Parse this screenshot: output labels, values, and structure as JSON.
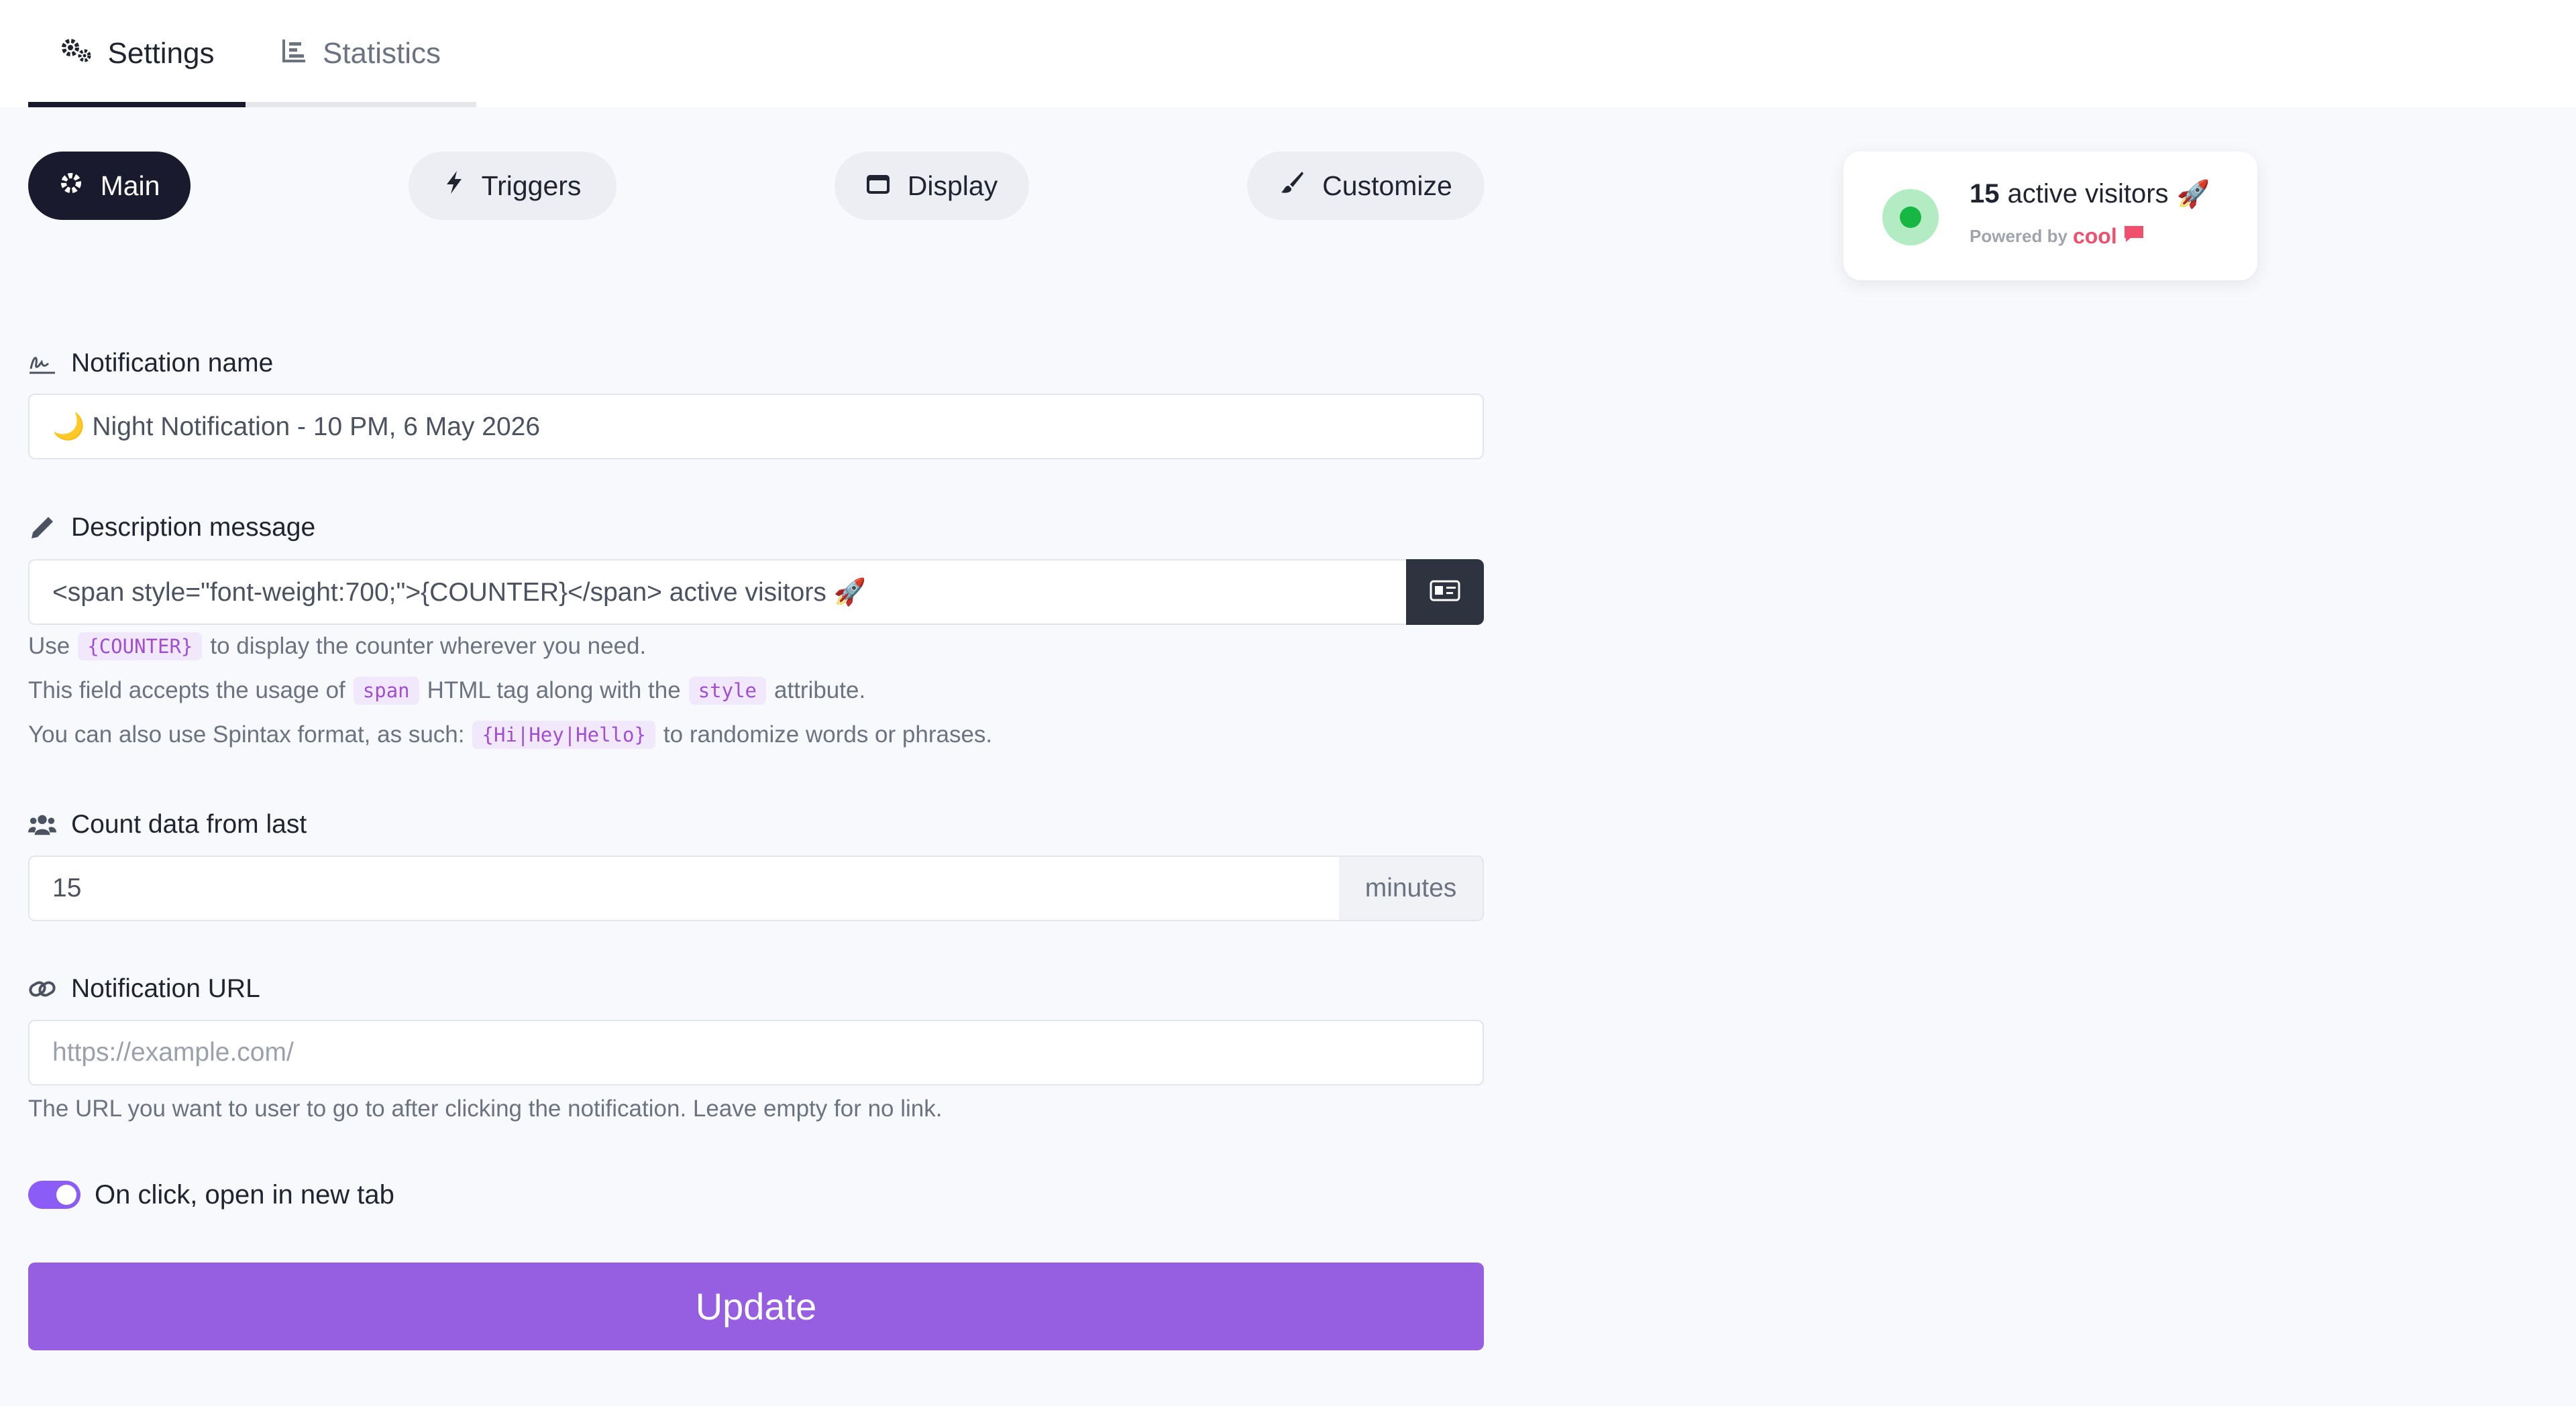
{
  "tabs": [
    {
      "label": "Settings",
      "icon": "gears-icon",
      "active": true
    },
    {
      "label": "Statistics",
      "icon": "bar-chart-icon",
      "active": false
    }
  ],
  "subnav": [
    {
      "label": "Main",
      "icon": "gear-icon",
      "active": true
    },
    {
      "label": "Triggers",
      "icon": "bolt-icon",
      "active": false
    },
    {
      "label": "Display",
      "icon": "window-icon",
      "active": false
    },
    {
      "label": "Customize",
      "icon": "paintbrush-icon",
      "active": false
    }
  ],
  "fields": {
    "name": {
      "label": "Notification name",
      "icon": "signature-icon",
      "value": "🌙 Night Notification - 10 PM, 6 May 2026"
    },
    "description": {
      "label": "Description message",
      "icon": "pencil-icon",
      "value": "<span style=\"font-weight:700;\">{COUNTER}</span> active visitors 🚀",
      "button_icon": "id-card-icon",
      "help": {
        "line1_pre": "Use",
        "line1_code": "{COUNTER}",
        "line1_post": "to display the counter wherever you need.",
        "line2_pre": "This field accepts the usage of",
        "line2_code1": "span",
        "line2_mid": "HTML tag along with the",
        "line2_code2": "style",
        "line2_post": "attribute.",
        "line3_pre": "You can also use Spintax format, as such:",
        "line3_code": "{Hi|Hey|Hello}",
        "line3_post": "to randomize words or phrases."
      }
    },
    "count": {
      "label": "Count data from last",
      "icon": "users-icon",
      "value": "15",
      "suffix": "minutes"
    },
    "url": {
      "label": "Notification URL",
      "icon": "link-icon",
      "placeholder": "https://example.com/",
      "help": "The URL you want to user to go to after clicking the notification. Leave empty for no link."
    }
  },
  "toggle": {
    "label": "On click, open in new tab",
    "checked": true
  },
  "submit": {
    "label": "Update"
  },
  "preview": {
    "count": "15",
    "text": "active visitors",
    "emoji": "🚀",
    "powered_by": "Powered by",
    "brand": "cool"
  },
  "colors": {
    "accent": "#965ee0",
    "dark": "#1a1a2e",
    "toggle": "#8b5cf6",
    "live_dot": "#16b742",
    "brand": "#f0506e"
  }
}
